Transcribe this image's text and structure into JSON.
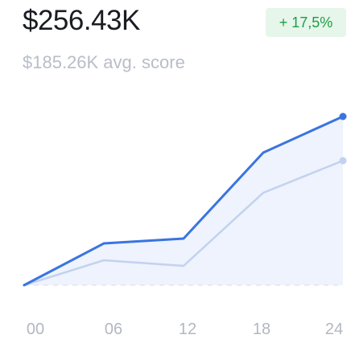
{
  "header": {
    "value": "$256.43K",
    "change": "+ 17,5%",
    "subtitle": "$185.26K avg. score"
  },
  "colors": {
    "primary_line": "#3a74e0",
    "secondary_line": "#c2d2ef",
    "area_fill": "#eef3fd",
    "baseline": "#e3e6ec",
    "badge_bg": "#e6f6ea",
    "badge_text": "#1f9d45"
  },
  "chart_data": {
    "type": "line",
    "title": "",
    "xlabel": "",
    "ylabel": "",
    "categories": [
      "00",
      "06",
      "12",
      "18",
      "24"
    ],
    "series": [
      {
        "values": [
          0,
          52,
          58,
          165,
          210
        ]
      },
      {
        "values": [
          0,
          31,
          24,
          115,
          155
        ]
      }
    ],
    "ylim": [
      0,
      230
    ],
    "grid": false,
    "legend": "none"
  }
}
